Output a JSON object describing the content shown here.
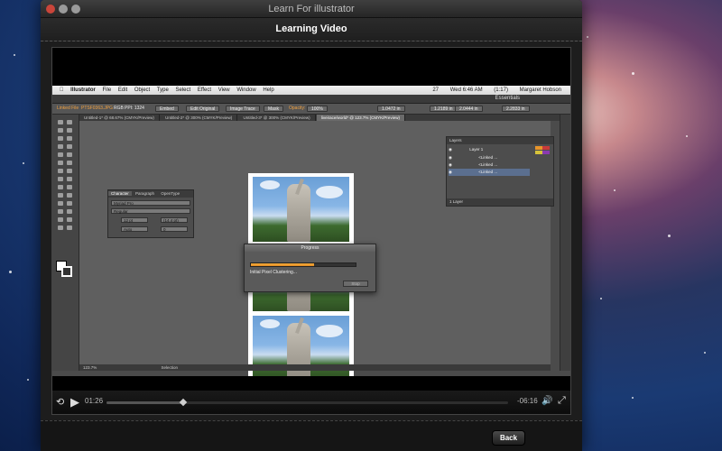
{
  "window": {
    "title": "Learn For illustrator"
  },
  "header": {
    "title": "Learning Video"
  },
  "illustrator": {
    "menubar": {
      "app": "Illustrator",
      "items": [
        "File",
        "Edit",
        "Object",
        "Type",
        "Select",
        "Effect",
        "View",
        "Window",
        "Help"
      ],
      "status_items": [
        "27",
        "Wed 6:46 AM",
        "(1:17)",
        "Margaret Hobson"
      ]
    },
    "workspace": "Essentials",
    "control_bar": {
      "selection": "Linked File",
      "file": "PTSF0363.JPG",
      "color_mode": "RGB",
      "ppi": "PPI: 1324",
      "embed": "Embed",
      "edit_original": "Edit Original",
      "image_trace": "Image Trace",
      "mask": "Mask",
      "opacity_label": "Opacity:",
      "opacity_value": "100%",
      "x": "1.0472 in",
      "y": "1.2189 in",
      "w": "2.0444 in",
      "h": "2.2833 in"
    },
    "doc_tabs": [
      "Untitled-1* @ 68.67% (CMYK/Preview)",
      "Untitled-2* @ 300% (CMYK/Preview)",
      "Untitled-3* @ 300% (CMYK/Preview)",
      "liveirace/world* @ 123.7% (CMYK/Preview)"
    ],
    "progress_dialog": {
      "title": "Progress",
      "message": "Initial Pixel Clustering...",
      "button": "Stop",
      "progress": 0.6
    },
    "character_panel": {
      "tabs": [
        "Character",
        "Paragraph",
        "OpenType"
      ],
      "font": "Myriad Pro",
      "style": "Regular",
      "size": "12 pt",
      "leading": "(14.4 pt)",
      "kerning": "Auto",
      "tracking": "0"
    },
    "layers_panel": {
      "tab": "Layers",
      "layer": "Layer 1",
      "items": [
        "<Linked ...",
        "<Linked ...",
        "<Linked ..."
      ],
      "footer": "1 Layer"
    },
    "statusbar": {
      "zoom": "123.7%",
      "tool": "Selection"
    }
  },
  "player": {
    "elapsed": "01:26",
    "remaining": "-06:16",
    "progress": 0.19
  },
  "footer": {
    "back_label": "Back"
  },
  "colors": {
    "accent_orange": "#e8952a",
    "window_bg": "#1d1d1d"
  }
}
